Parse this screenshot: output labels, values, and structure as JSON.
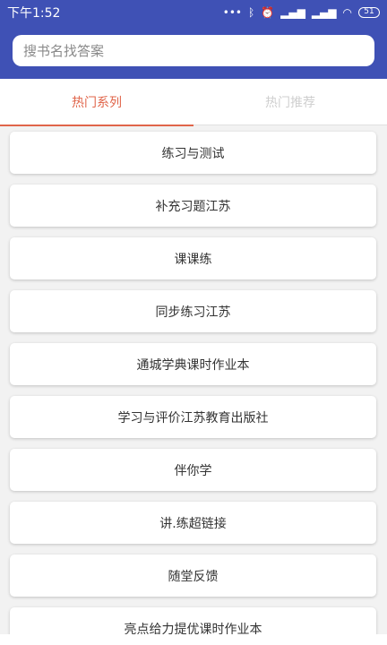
{
  "status_bar": {
    "time": "下午1:52",
    "battery": "51"
  },
  "search": {
    "placeholder": "搜书名找答案"
  },
  "tabs": [
    {
      "label": "热门系列",
      "active": true
    },
    {
      "label": "热门推荐",
      "active": false
    }
  ],
  "list": {
    "items": [
      "练习与测试",
      "补充习题江苏",
      "课课练",
      "同步练习江苏",
      "通城学典课时作业本",
      "学习与评价江苏教育出版社",
      "伴你学",
      "讲.练超链接",
      "随堂反馈",
      "亮点给力提优课时作业本"
    ]
  },
  "colors": {
    "primary": "#3f51b5",
    "accent": "#e0654a"
  }
}
